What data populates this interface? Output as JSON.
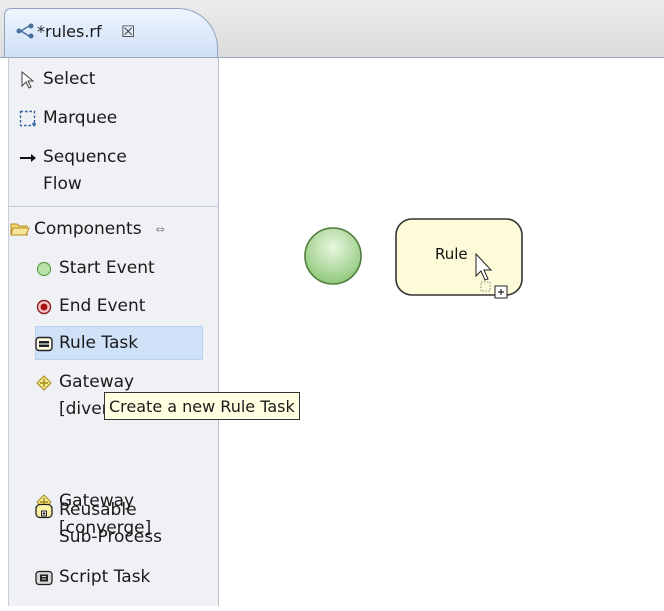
{
  "editor_tab": {
    "title": "*rules.rf",
    "close_glyph": "☒"
  },
  "palette": {
    "tools": [
      {
        "label": "Select",
        "icon": "select-arrow-icon"
      },
      {
        "label": "Marquee",
        "icon": "marquee-icon"
      },
      {
        "label": "Sequence Flow",
        "label_line1": "Sequence",
        "label_line2": "Flow",
        "icon": "arrow-right-icon"
      }
    ],
    "drawer": {
      "label": "Components",
      "icon": "folder-open-icon"
    },
    "components": [
      {
        "label": "Start Event",
        "icon": "start-event-icon"
      },
      {
        "label": "End Event",
        "icon": "end-event-icon"
      },
      {
        "label": "Rule Task",
        "icon": "rule-task-icon",
        "selected": true
      },
      {
        "label_line1": "Gateway",
        "label_line2": "[diverge]",
        "icon": "gateway-icon"
      },
      {
        "label_line1": "Gateway",
        "label_line2": "[converge]",
        "icon": "gateway-icon"
      },
      {
        "label_line1": "Reusable",
        "label_line2": "Sub-Process",
        "icon": "subprocess-icon"
      },
      {
        "label": "Script Task",
        "icon": "script-task-icon"
      }
    ]
  },
  "canvas": {
    "rule_node_label": "Rule"
  },
  "tooltip": {
    "text": "Create a new Rule Task"
  },
  "colors": {
    "tab_active": "#cfe0f6",
    "palette_bg": "#eff1f4",
    "selection": "#cfe1f7",
    "tooltip_bg": "#ffffe1",
    "node_fill": "#fdfbd8",
    "start_event_green": "#9fd08a"
  }
}
